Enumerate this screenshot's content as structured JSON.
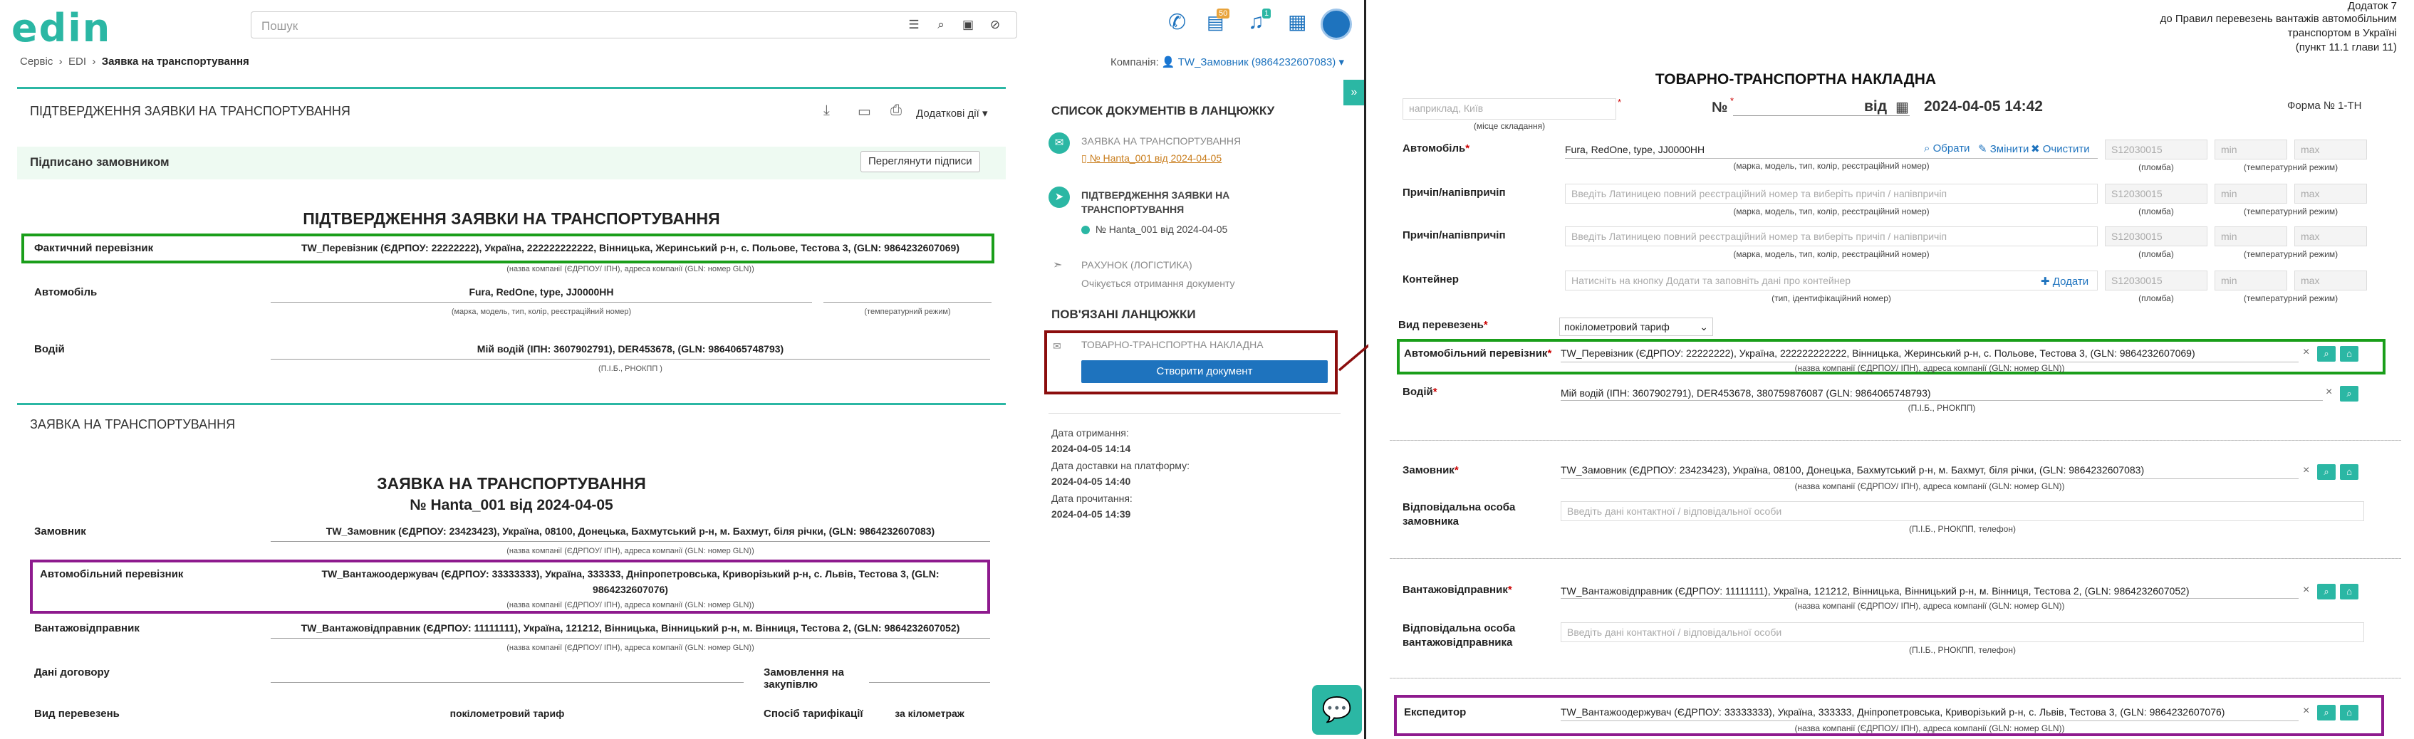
{
  "app": {
    "logo": "edin"
  },
  "top": {
    "search_placeholder": "Пошук",
    "badge_docs": "50",
    "badge_bell": "1"
  },
  "breadcrumb": {
    "items": [
      "Сервіс",
      "EDI",
      "Заявка на транспортування"
    ]
  },
  "company": {
    "label": "Компанія:",
    "value": "TW_Замовник (9864232607083)"
  },
  "confirm_section": {
    "title": "ПІДТВЕРДЖЕННЯ ЗАЯВКИ НА ТРАНСПОРТУВАННЯ",
    "extra_actions": "Додаткові дії",
    "signed_text": "Підписано замовником",
    "view_signatures": "Переглянути підписи",
    "doc_title": "ПІДТВЕРДЖЕННЯ ЗАЯВКИ НА ТРАНСПОРТУВАННЯ",
    "carrier_label": "Фактичний перевізник",
    "carrier_value": "TW_Перевізник (ЄДРПОУ: 22222222), Україна, 222222222222, Вінницька, Жеринський р-н, с. Польове, Тестова 3, (GLN: 9864232607069)",
    "carrier_hint": "(назва компанії (ЄДРПОУ/ ІПН), адреса компанії (GLN: номер GLN))",
    "car_label": "Автомобіль",
    "car_value": "Fura, RedOne, type, JJ0000HH",
    "car_hint": "(марка, модель, тип, колір, реєстраційний номер)",
    "temp_hint": "(температурний режим)",
    "driver_label": "Водій",
    "driver_value": "Мій водій (ІПН: 3607902791), DER453678, (GLN: 9864065748793)",
    "driver_hint": "(П.І.Б., РНОКПП )"
  },
  "request_section": {
    "title": "ЗАЯВКА НА ТРАНСПОРТУВАННЯ",
    "doc_title": "ЗАЯВКА НА ТРАНСПОРТУВАННЯ",
    "doc_number": "№ Hanta_001 від 2024-04-05",
    "customer_label": "Замовник",
    "customer_value": "TW_Замовник (ЄДРПОУ: 23423423), Україна, 08100, Донецька, Бахмутський р-н, м. Бахмут, біля річки, (GLN: 9864232607083)",
    "company_hint": "(назва компанії (ЄДРПОУ/ ІПН), адреса компанії (GLN: номер GLN))",
    "auto_carrier_label": "Автомобільний перевізник",
    "auto_carrier_value_1": "TW_Вантажоодержувач (ЄДРПОУ: 33333333), Україна, 333333, Дніпропетровська, Криворізький р-н, с. Львів, Тестова 3, (GLN:",
    "auto_carrier_value_2": "9864232607076)",
    "shipper_label": "Вантажовідправник",
    "shipper_value": "TW_Вантажовідправник (ЄДРПОУ: 11111111), Україна, 121212, Вінницька, Вінницький р-н, м. Вінниця, Тестова 2, (GLN: 9864232607052)",
    "contract_label": "Дані договору",
    "order_label": "Замовлення на закупівлю",
    "transport_type_label": "Вид перевезень",
    "transport_type_value": "покілометровий тариф",
    "tariff_label": "Спосіб тарифікації",
    "tariff_value": "за кілометраж"
  },
  "chain": {
    "title": "СПИСОК ДОКУМЕНТІВ В ЛАНЦЮЖКУ",
    "item1_title": "ЗАЯВКА НА ТРАНСПОРТУВАННЯ",
    "item1_sub": "№ Hanta_001 від 2024-04-05",
    "item2_title_1": "ПІДТВЕРДЖЕННЯ ЗАЯВКИ НА",
    "item2_title_2": "ТРАНСПОРТУВАННЯ",
    "item2_sub": "№ Hanta_001 від 2024-04-05",
    "item3_title": "РАХУНОК (ЛОГІСТИКА)",
    "item3_sub": "Очікується отримання документу",
    "linked_title": "ПОВ'ЯЗАНІ ЛАНЦЮЖКИ",
    "linked_item": "ТОВАРНО-ТРАНСПОРТНА НАКЛАДНА",
    "create_button": "Створити документ",
    "received_label": "Дата отримання:",
    "received_value": "2024-04-05 14:14",
    "delivered_label": "Дата доставки на платформу:",
    "delivered_value": "2024-04-05 14:40",
    "read_label": "Дата прочитання:",
    "read_value": "2024-04-05 14:39"
  },
  "ttn": {
    "appendix_1": "Додаток 7",
    "appendix_2": "до Правил перевезень вантажів автомобільним",
    "appendix_3": "транспортом в Україні",
    "appendix_4": "(пункт 11.1 глави 11)",
    "place_placeholder": "наприклад, Київ",
    "place_hint": "(місце складання)",
    "title": "ТОВАРНО-ТРАНСПОРТНА НАКЛАДНА",
    "number_label": "№",
    "date_label": "від",
    "date_value": "2024-04-05 14:42",
    "form_label": "Форма № 1-ТН",
    "car_label": "Автомобіль",
    "car_value": "Fura, RedOne, type, JJ0000HH",
    "car_hint": "(марка, модель, тип, колір, реєстраційний номер)",
    "choose": "Обрати",
    "change": "Змінити",
    "clear": "Очистити",
    "seal_placeholder": "S12030015",
    "seal_hint": "(пломба)",
    "min_placeholder": "min",
    "max_placeholder": "max",
    "temp_hint": "(температурний режим)",
    "trailer_label": "Причіп/напівпричіп",
    "trailer_placeholder": "Введіть Латиницею повний реєстраційний номер та виберіть причіп / напівпричіп",
    "container_label": "Контейнер",
    "container_placeholder": "Натисніть на кнопку Додати та заповніть дані про контейнер",
    "container_add": "Додати",
    "container_hint": "(тип, ідентифікаційний номер)",
    "transport_type_label": "Вид перевезень",
    "transport_type_value": "покілометровий тариф",
    "auto_carrier_label": "Автомобільний перевізник",
    "auto_carrier_value": "TW_Перевізник (ЄДРПОУ: 22222222), Україна, 222222222222, Вінницька, Жеринський р-н, с. Польове, Тестова 3, (GLN: 9864232607069)",
    "company_hint": "(назва компанії (ЄДРПОУ/ ІПН), адреса компанії (GLN: номер GLN))",
    "driver_label": "Водій",
    "driver_value": "Мій водій (ІПН: 3607902791), DER453678, 380759876087 (GLN: 9864065748793)",
    "driver_hint": "(П.І.Б., РНОКПП)",
    "customer_label": "Замовник",
    "customer_value": "TW_Замовник (ЄДРПОУ: 23423423), Україна, 08100, Донецька, Бахмутський р-н, м. Бахмут, біля річки, (GLN: 9864232607083)",
    "resp_customer_label_1": "Відповідальна особа",
    "resp_customer_label_2": "замовника",
    "resp_placeholder": "Введіть дані контактної / відповідальної особи",
    "resp_hint": "(П.І.Б., РНОКПП, телефон)",
    "shipper_label": "Вантажовідправник",
    "shipper_value": "TW_Вантажовідправник (ЄДРПОУ: 11111111), Україна, 121212, Вінницька, Вінницький р-н, м. Вінниця, Тестова 2, (GLN: 9864232607052)",
    "resp_shipper_label_1": "Відповідальна особа",
    "resp_shipper_label_2": "вантажовідправника",
    "forwarder_label": "Експедитор",
    "forwarder_value": "TW_Вантажоодержувач (ЄДРПОУ: 33333333), Україна, 333333, Дніпропетровська, Криворізький р-н, с. Львів, Тестова 3, (GLN: 9864232607076)"
  },
  "colors": {
    "accent": "#2bb7a4",
    "blue": "#1e73be",
    "green_box": "#1a9e1a",
    "purple_box": "#8e1a8e",
    "red_box": "#8b0d0d"
  }
}
